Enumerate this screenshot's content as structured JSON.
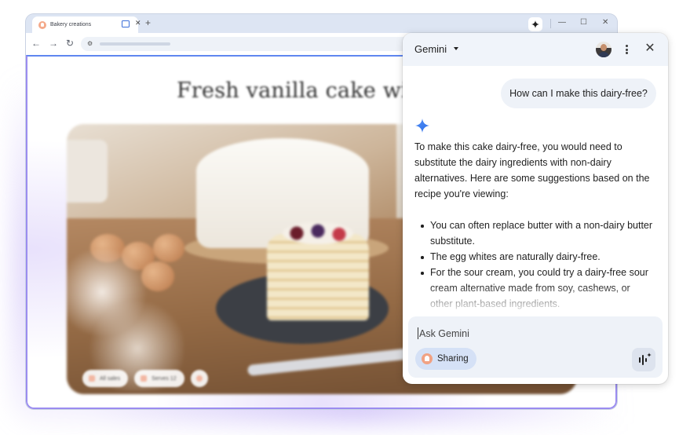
{
  "browser": {
    "tab_title": "Bakery creations",
    "tab_close": "✕",
    "new_tab": "+",
    "window_controls": {
      "minimize": "—",
      "maximize": "☐",
      "close": "✕"
    },
    "nav": {
      "back": "←",
      "forward": "→",
      "reload": "↻"
    },
    "omnibox_icon": "site-settings-icon"
  },
  "page": {
    "title": "Fresh vanilla cake with l",
    "chips": [
      "All sales",
      "Serves 12"
    ]
  },
  "gemini": {
    "header_title": "Gemini",
    "close": "✕",
    "user_message": "How can I make this dairy-free?",
    "answer_intro": "To make this cake dairy-free, you would need to substitute the dairy ingredients with non-dairy alternatives. Here are some suggestions based on the recipe you're viewing:",
    "answer_items": [
      "You can often replace butter with a non-dairy butter substitute.",
      "The egg whites are naturally dairy-free.",
      "For the sour cream, you could try a dairy-free sour cream alternative made from soy, cashews, or other plant-based ingredients."
    ],
    "input_placeholder": "Ask Gemini",
    "sharing_label": "Sharing",
    "colors": {
      "accent": "#4285f4",
      "chip_bg": "#d5e1f6",
      "panel_header": "#f0f4fa"
    }
  }
}
